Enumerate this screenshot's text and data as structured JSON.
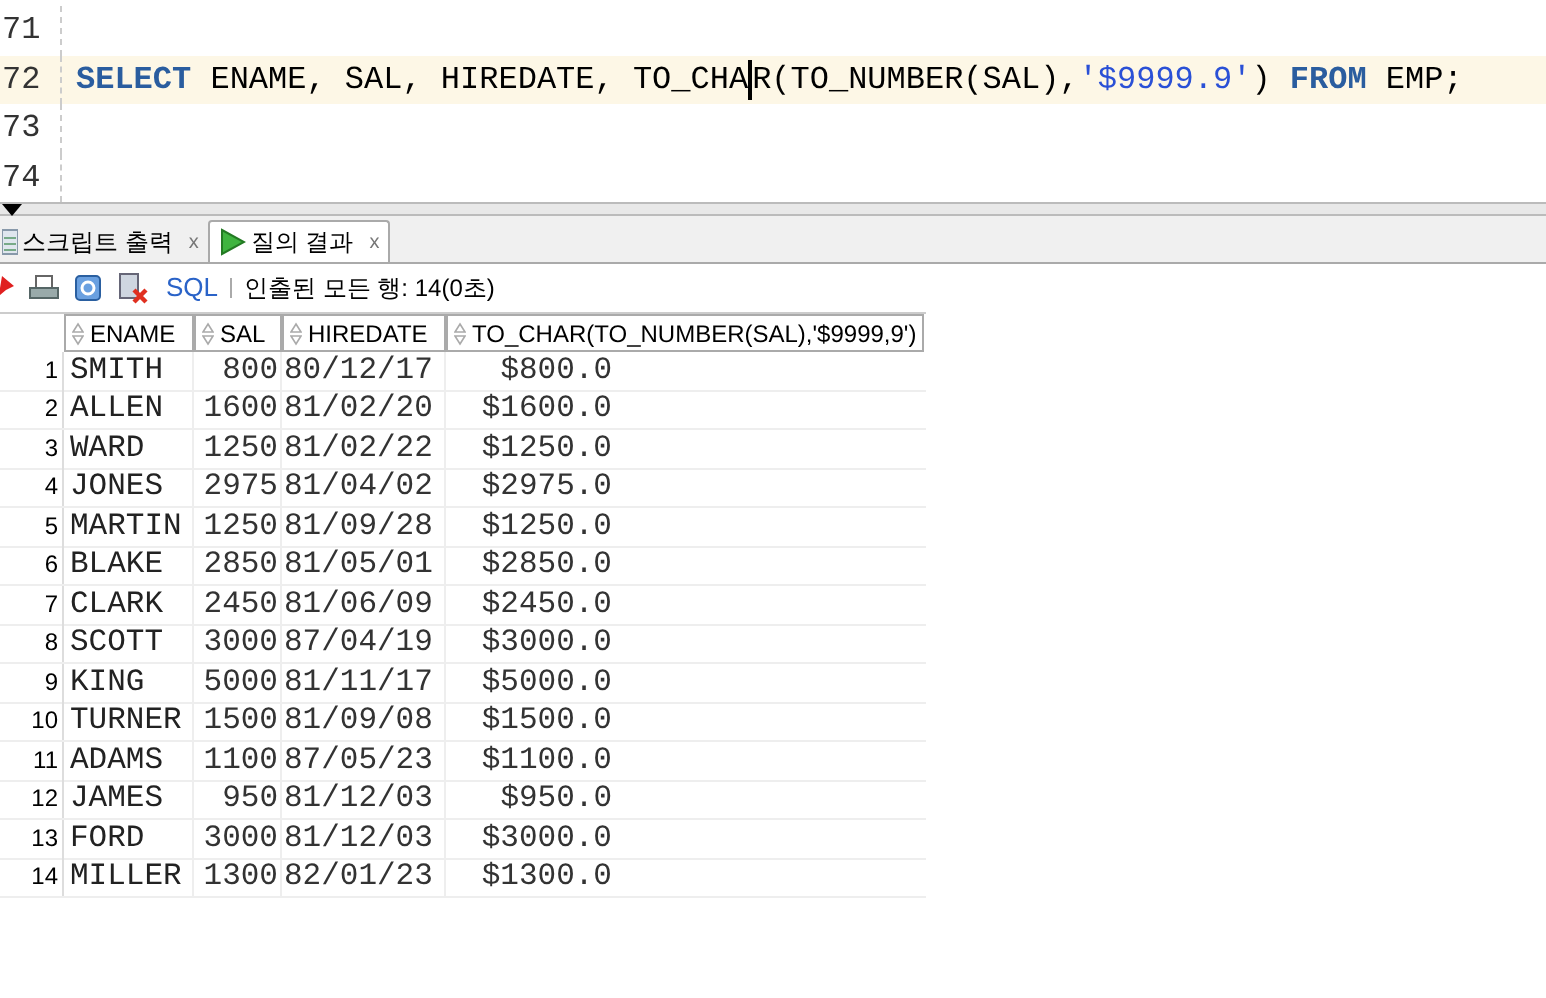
{
  "editor": {
    "lines": [
      {
        "number": "71",
        "current": false
      },
      {
        "number": "72",
        "current": true,
        "tokens": [
          {
            "kind": "keyword",
            "text": "SELECT"
          },
          {
            "kind": "plain",
            "text": " ENAME, SAL, HIREDATE, TO_CHA"
          },
          {
            "kind": "cursor"
          },
          {
            "kind": "plain",
            "text": "R(TO_NUMBER(SAL),"
          },
          {
            "kind": "string",
            "text": "'$9999.9'"
          },
          {
            "kind": "plain",
            "text": ") "
          },
          {
            "kind": "keyword",
            "text": "FROM"
          },
          {
            "kind": "plain",
            "text": " EMP;"
          }
        ]
      },
      {
        "number": "73",
        "current": false
      },
      {
        "number": "74",
        "current": false
      }
    ]
  },
  "tabs": [
    {
      "label": "스크립트 출력",
      "kind": "script",
      "selected": false,
      "close": "x"
    },
    {
      "label": "질의 결과",
      "kind": "query",
      "selected": true,
      "close": "x"
    }
  ],
  "toolbar": {
    "sql": "SQL",
    "status": "인출된 모든 행: 14(0초)"
  },
  "table": {
    "columns": [
      "",
      "ENAME",
      "SAL",
      "HIREDATE",
      "TO_CHAR(TO_NUMBER(SAL),'$9999,9')"
    ],
    "rows": [
      [
        "1",
        "SMITH",
        "800",
        "80/12/17",
        "$800.0"
      ],
      [
        "2",
        "ALLEN",
        "1600",
        "81/02/20",
        "$1600.0"
      ],
      [
        "3",
        "WARD",
        "1250",
        "81/02/22",
        "$1250.0"
      ],
      [
        "4",
        "JONES",
        "2975",
        "81/04/02",
        "$2975.0"
      ],
      [
        "5",
        "MARTIN",
        "1250",
        "81/09/28",
        "$1250.0"
      ],
      [
        "6",
        "BLAKE",
        "2850",
        "81/05/01",
        "$2850.0"
      ],
      [
        "7",
        "CLARK",
        "2450",
        "81/06/09",
        "$2450.0"
      ],
      [
        "8",
        "SCOTT",
        "3000",
        "87/04/19",
        "$3000.0"
      ],
      [
        "9",
        "KING",
        "5000",
        "81/11/17",
        "$5000.0"
      ],
      [
        "10",
        "TURNER",
        "1500",
        "81/09/08",
        "$1500.0"
      ],
      [
        "11",
        "ADAMS",
        "1100",
        "87/05/23",
        "$1100.0"
      ],
      [
        "12",
        "JAMES",
        "950",
        "81/12/03",
        "$950.0"
      ],
      [
        "13",
        "FORD",
        "3000",
        "81/12/03",
        "$3000.0"
      ],
      [
        "14",
        "MILLER",
        "1300",
        "82/01/23",
        "$1300.0"
      ]
    ]
  }
}
